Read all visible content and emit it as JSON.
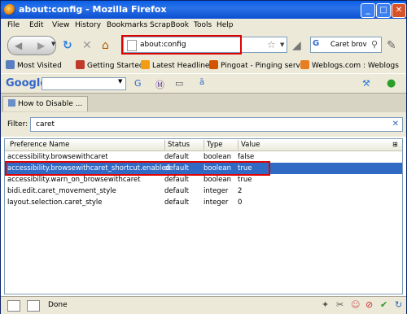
{
  "window": {
    "title": "about:config - Mozilla Firefox",
    "min_label": "_",
    "max_label": "□",
    "close_label": "✕"
  },
  "menubar": {
    "items": [
      "File",
      "Edit",
      "View",
      "History",
      "Bookmarks",
      "ScrapBook",
      "Tools",
      "Help"
    ]
  },
  "navbar": {
    "url": "about:config",
    "search_value": "Caret brov",
    "search_engine_icon": "google-icon"
  },
  "bookmarks": {
    "items": [
      {
        "label": "Most Visited",
        "color": "#5a7fc0"
      },
      {
        "label": "Getting Started",
        "color": "#c0392b"
      },
      {
        "label": "Latest Headlines",
        "color": "#f39c12"
      },
      {
        "label": "Pingoat - Pinging servi...",
        "color": "#d35400"
      },
      {
        "label": "Weblogs.com : Weblogs",
        "color": "#e67e22"
      }
    ]
  },
  "googlebar": {
    "logo": "Google"
  },
  "tabs": [
    {
      "label": "How to Disable ..."
    }
  ],
  "filter": {
    "label": "Filter:",
    "value": "caret"
  },
  "table": {
    "columns": [
      "Preference Name",
      "Status",
      "Type",
      "Value"
    ],
    "rows": [
      {
        "name": "accessibility.browsewithcaret",
        "status": "default",
        "type": "boolean",
        "value": "false"
      },
      {
        "name": "accessibility.browsewithcaret_shortcut.enabled",
        "status": "default",
        "type": "boolean",
        "value": "true"
      },
      {
        "name": "accessibility.warn_on_browsewithcaret",
        "status": "default",
        "type": "boolean",
        "value": "true"
      },
      {
        "name": "bidi.edit.caret_movement_style",
        "status": "default",
        "type": "integer",
        "value": "2"
      },
      {
        "name": "layout.selection.caret_style",
        "status": "default",
        "type": "integer",
        "value": "0"
      }
    ],
    "selected_row": 1
  },
  "status": {
    "text": "Done"
  },
  "colors": {
    "titlebar": "#0a5ee8",
    "selection": "#316ac5",
    "highlight_box": "#e00000"
  }
}
